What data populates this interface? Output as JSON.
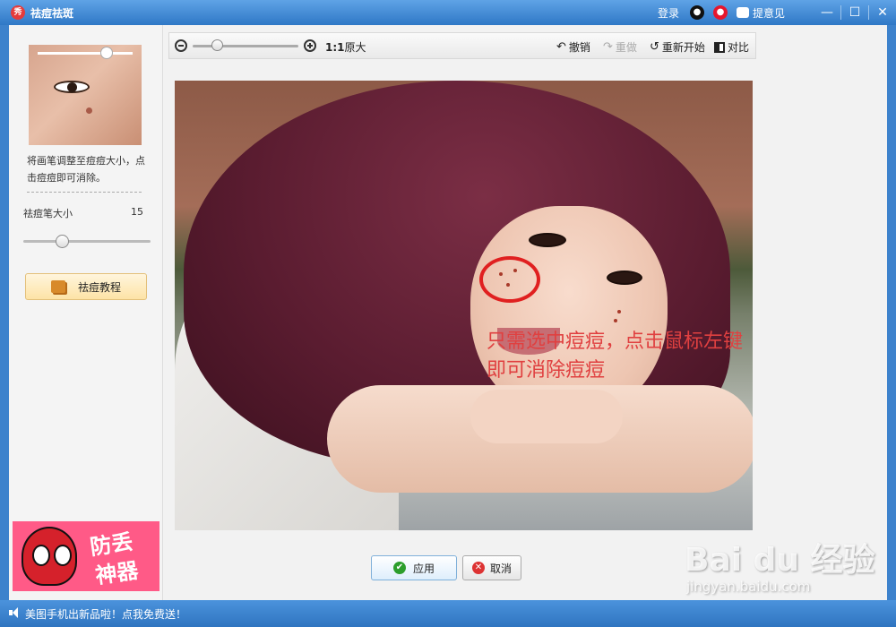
{
  "window": {
    "title": "祛痘祛斑",
    "logo_text": "秀",
    "login_label": "登录",
    "qq_icon": "qq-icon",
    "weibo_icon": "weibo-icon",
    "feedback_label": "提意见",
    "minimize": "—",
    "maximize": "☐",
    "close": "✕"
  },
  "sidebar": {
    "hint_text": "将画笔调整至痘痘大小，点击痘痘即可消除。",
    "brush_size_label": "祛痘笔大小",
    "brush_size_value": "15",
    "brush_size_fraction": 0.3,
    "tutorial_label": "祛痘教程",
    "ad": {
      "line1": "防丢",
      "line2": "神器"
    }
  },
  "toolbar": {
    "zoom_fraction": 0.18,
    "actual_size_ratio": "1:1",
    "actual_size_label": "原大",
    "undo_label": "撤销",
    "redo_label": "重做",
    "reset_label": "重新开始",
    "compare_label": "对比"
  },
  "canvas": {
    "annotation": "只需选中痘痘，点击鼠标左键即可消除痘痘"
  },
  "buttons": {
    "apply_label": "应用",
    "cancel_label": "取消"
  },
  "watermark": {
    "logo": "Bai du 经验",
    "url": "jingyan.baidu.com"
  },
  "status": {
    "message": "美图手机出新品啦！点我免费送！"
  },
  "colors": {
    "titlebar": "#2f78c6",
    "annotation": "#e04040",
    "circle": "#e02020"
  }
}
